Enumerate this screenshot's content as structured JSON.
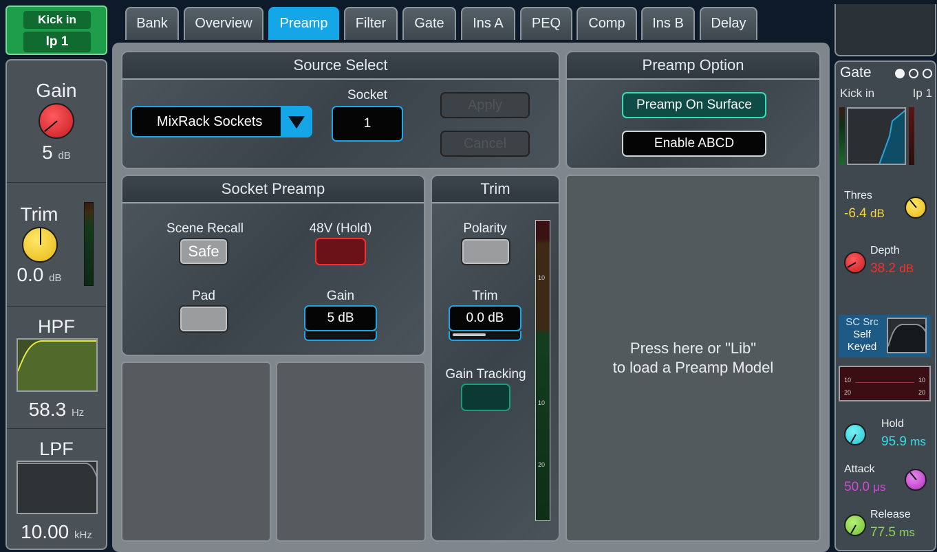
{
  "channel": {
    "name": "Kick in",
    "source": "Ip 1"
  },
  "tabs": [
    {
      "label": "Bank",
      "active": false
    },
    {
      "label": "Overview",
      "active": false
    },
    {
      "label": "Preamp",
      "active": true
    },
    {
      "label": "Filter",
      "active": false
    },
    {
      "label": "Gate",
      "active": false
    },
    {
      "label": "Ins A",
      "active": false
    },
    {
      "label": "PEQ",
      "active": false
    },
    {
      "label": "Comp",
      "active": false
    },
    {
      "label": "Ins B",
      "active": false
    },
    {
      "label": "Delay",
      "active": false
    }
  ],
  "left": {
    "gain": {
      "label": "Gain",
      "value": "5",
      "unit": "dB"
    },
    "trim": {
      "label": "Trim",
      "value": "0.0",
      "unit": "dB"
    },
    "hpf": {
      "label": "HPF",
      "value": "58.3",
      "unit": "Hz"
    },
    "lpf": {
      "label": "LPF",
      "value": "10.00",
      "unit": "kHz"
    }
  },
  "source_select": {
    "title": "Source Select",
    "dropdown_value": "MixRack Sockets",
    "socket_label": "Socket",
    "socket_value": "1",
    "apply_label": "Apply",
    "cancel_label": "Cancel"
  },
  "preamp_option": {
    "title": "Preamp Option",
    "preamp_on_surface_label": "Preamp On Surface",
    "enable_abcd_label": "Enable ABCD"
  },
  "socket_preamp": {
    "title": "Socket Preamp",
    "scene_recall_label": "Scene Recall",
    "safe_label": "Safe",
    "phantom_label": "48V (Hold)",
    "pad_label": "Pad",
    "gain_label": "Gain",
    "gain_value": "5 dB"
  },
  "trim": {
    "title": "Trim",
    "polarity_label": "Polarity",
    "trim_label": "Trim",
    "trim_value": "0.0 dB",
    "gain_tracking_label": "Gain Tracking",
    "meter_scale": [
      "10",
      "10",
      "20"
    ]
  },
  "preamp_model": {
    "line1": "Press here or \"Lib\"",
    "line2": "to load a Preamp Model"
  },
  "gate": {
    "title": "Gate",
    "channel_name": "Kick in",
    "channel_source": "Ip 1",
    "thres_label": "Thres",
    "thres_value": "-6.4",
    "thres_unit": "dB",
    "depth_label": "Depth",
    "depth_value": "38.2",
    "depth_unit": "dB",
    "sc_src_label": "SC Src",
    "sc_self_label": "Self",
    "sc_keyed_label": "Keyed",
    "gr_scale": [
      "10",
      "20",
      "10",
      "20"
    ],
    "hold_label": "Hold",
    "hold_value": "95.9",
    "hold_unit": "ms",
    "attack_label": "Attack",
    "attack_value": "50.0",
    "attack_unit": "μs",
    "release_label": "Release",
    "release_value": "77.5",
    "release_unit": "ms"
  },
  "colors": {
    "accent": "#14a6e6",
    "channel_green": "#1e9e4a",
    "gain_knob": "#e02a2e",
    "trim_knob": "#f2cf2a",
    "thres_color": "#f3d83a",
    "depth_color": "#ff2a2a",
    "hold_color": "#2ee0e8",
    "attack_color": "#d04ad8",
    "release_color": "#8ad84a"
  }
}
